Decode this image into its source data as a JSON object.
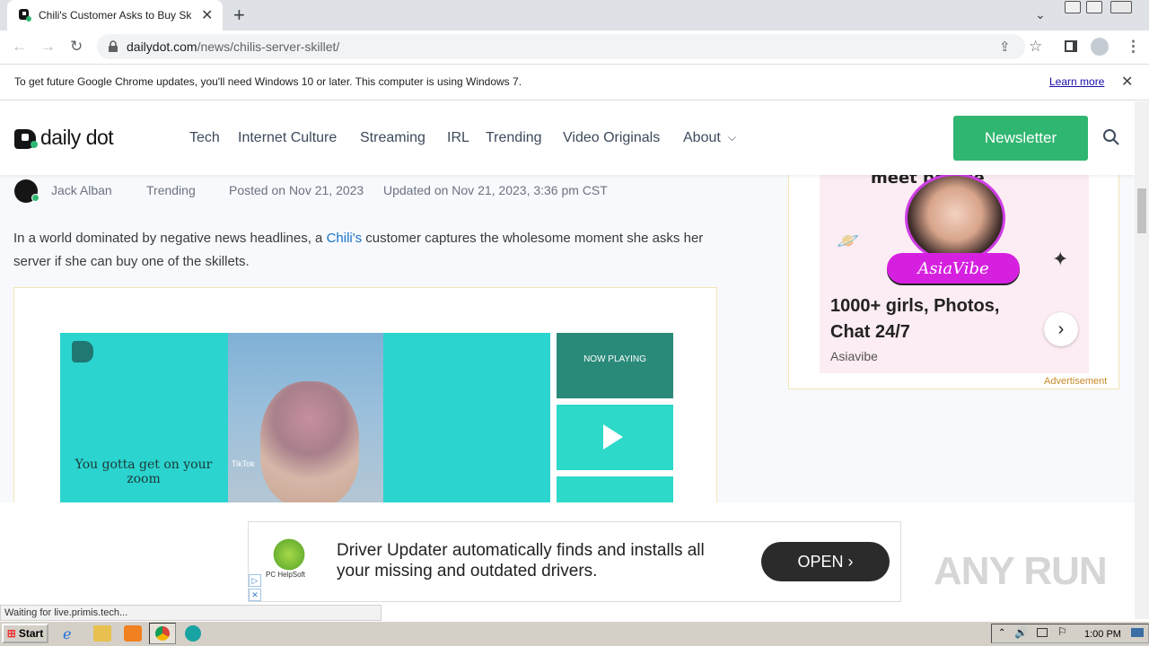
{
  "browser": {
    "tab_title": "Chili's Customer Asks to Buy Skillet A",
    "url_host": "dailydot.com",
    "url_path": "/news/chilis-server-skillet/",
    "infobar_text": "To get future Google Chrome updates, you'll need Windows 10 or later. This computer is using Windows 7.",
    "infobar_link": "Learn more",
    "status_text": "Waiting for live.primis.tech..."
  },
  "site": {
    "logo_text": "daily dot",
    "nav": [
      "Tech",
      "Internet Culture",
      "Streaming",
      "IRL",
      "Trending",
      "Video Originals",
      "About"
    ],
    "newsletter_label": "Newsletter"
  },
  "article": {
    "author": "Jack Alban",
    "category": "Trending",
    "posted": "Posted on Nov 21, 2023",
    "updated": "Updated on Nov 21, 2023, 3:36 pm CST",
    "intro_before": "In a world dominated by negative news headlines, a ",
    "intro_link": "Chili's",
    "intro_after": " customer captures the wholesome moment she asks her server if she can buy one of the skillets."
  },
  "video": {
    "caption": "You gotta get on your zoom",
    "tiktok_label": "TikTok",
    "now_playing": "NOW PLAYING"
  },
  "side_ad": {
    "arc_text": "meet people",
    "brand_pill": "AsiaVibe",
    "headline": "1000+ girls, Photos, Chat 24/7",
    "brand": "Asiavibe",
    "label": "Advertisement"
  },
  "bottom_ad": {
    "logo_text": "PC HelpSoft",
    "text": "Driver Updater automatically finds and installs all your missing and outdated drivers.",
    "button": "OPEN"
  },
  "watermark": "ANY RUN",
  "taskbar": {
    "start": "Start",
    "clock": "1:00 PM"
  },
  "colors": {
    "accent_green": "#2fb670",
    "link_blue": "#1a73c8",
    "player_teal": "#2bd4cf",
    "ad_pink": "#d620e0"
  }
}
